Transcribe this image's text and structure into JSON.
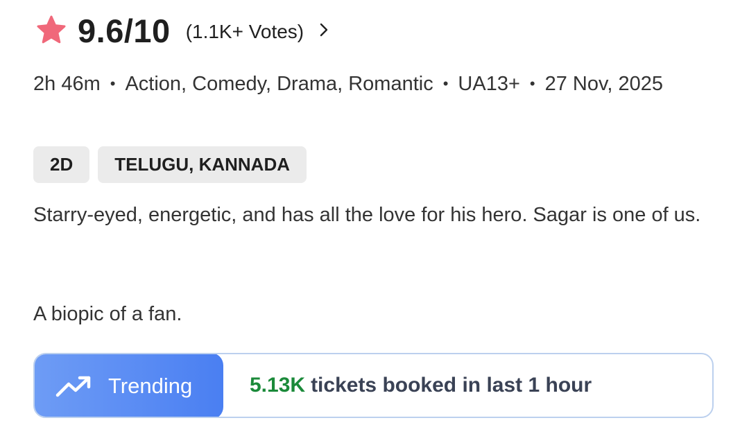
{
  "rating": {
    "value": "9.6/10",
    "votes": "(1.1K+ Votes)",
    "star_icon": "star-icon",
    "star_color": "#f0687a"
  },
  "meta": {
    "duration": "2h 46m",
    "genres": "Action, Comedy, Drama, Romantic",
    "certificate": "UA13+",
    "release_date": "27 Nov, 2025",
    "separator": "•"
  },
  "chips": [
    {
      "label": "2D"
    },
    {
      "label": "TELUGU, KANNADA"
    }
  ],
  "description": "Starry-eyed, energetic, and has all the love for his hero. Sagar is one of us.",
  "tagline": "A biopic of a fan.",
  "trending": {
    "badge_label": "Trending",
    "count": "5.13K",
    "text": "tickets booked in last 1 hour",
    "count_color": "#1b8a3a",
    "accent": "#4a7ff2"
  }
}
